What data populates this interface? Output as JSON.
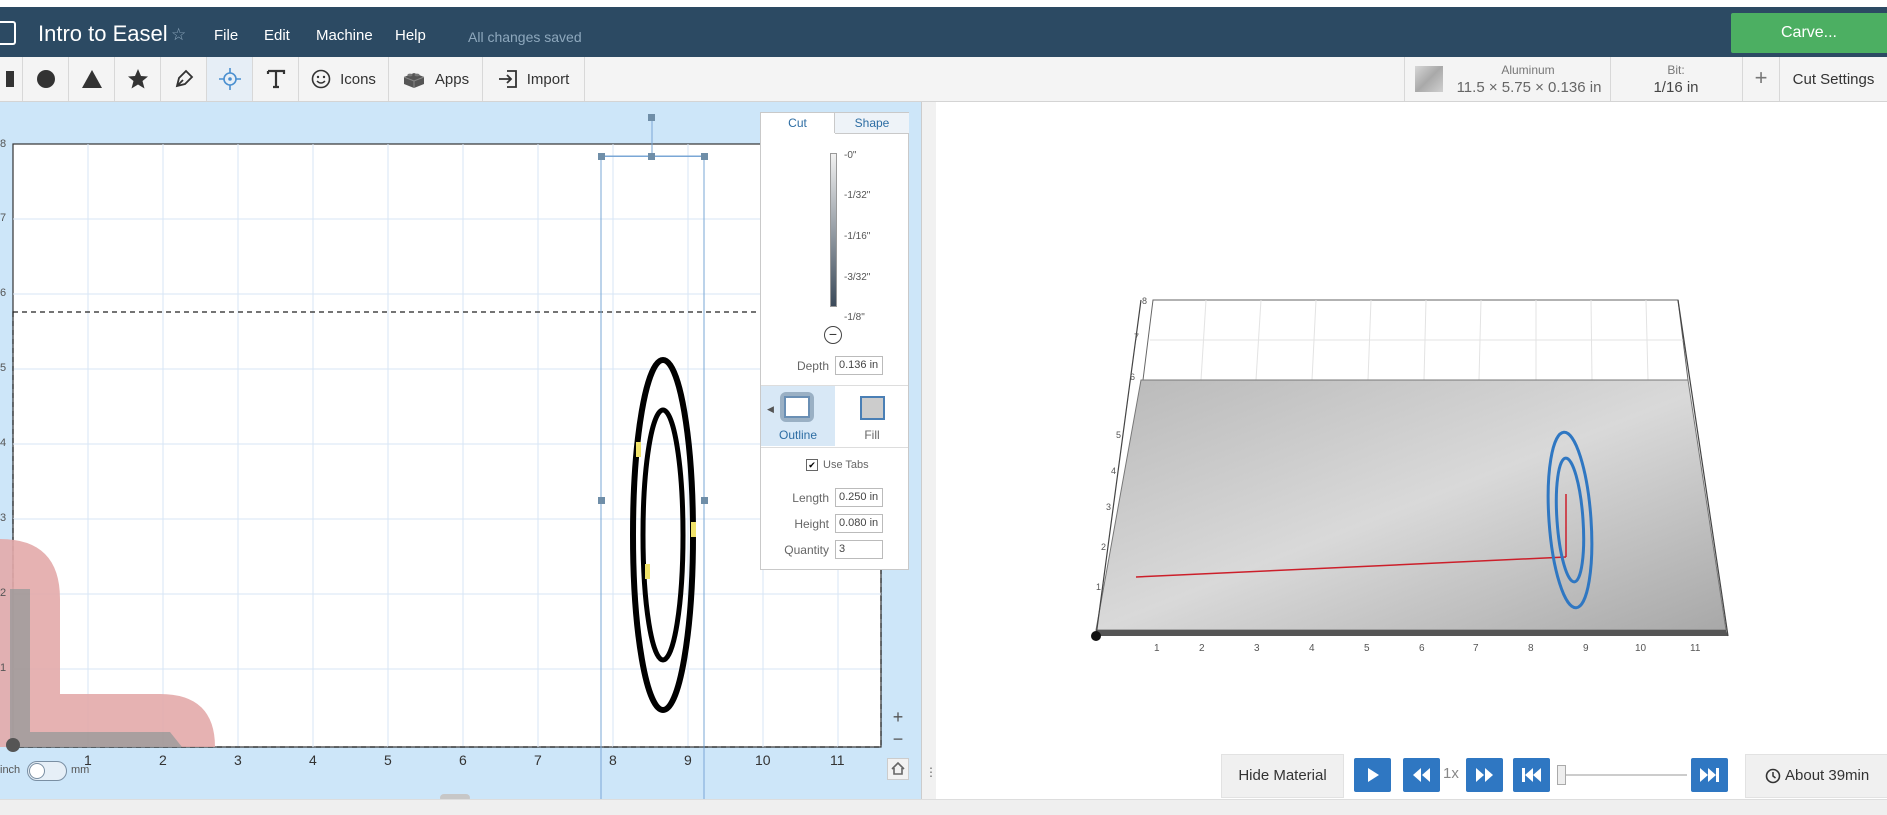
{
  "header": {
    "title": "Intro to Easel",
    "star": "☆",
    "menu": [
      "File",
      "Edit",
      "Machine",
      "Help"
    ],
    "status": "All changes saved",
    "carve_label": "Carve..."
  },
  "toolbar": {
    "icons_label": "Icons",
    "apps_label": "Apps",
    "import_label": "Import",
    "material_name": "Aluminum",
    "material_dims": "11.5 × 5.75 × 0.136 in",
    "bit_label": "Bit:",
    "bit_value": "1/16 in",
    "plus_label": "+",
    "cut_settings_label": "Cut Settings"
  },
  "canvas": {
    "x_ticks": [
      "1",
      "2",
      "3",
      "4",
      "5",
      "6",
      "7",
      "8",
      "9",
      "10",
      "11"
    ],
    "y_ticks": [
      "8",
      "7",
      "6",
      "5",
      "4",
      "3",
      "2",
      "1"
    ],
    "unit_inch": "inch",
    "unit_mm": "mm",
    "zoom_in": "+",
    "zoom_out": "−"
  },
  "cut_panel": {
    "tab_cut": "Cut",
    "tab_shape": "Shape",
    "depth_marks": [
      "-0\"",
      "-1/32\"",
      "-1/16\"",
      "-3/32\"",
      "-1/8\""
    ],
    "depth_label": "Depth",
    "depth_value": "0.136 in",
    "outline_label": "Outline",
    "fill_label": "Fill",
    "use_tabs_label": "Use Tabs",
    "length_label": "Length",
    "length_value": "0.250 in",
    "height_label": "Height",
    "height_value": "0.080 in",
    "quantity_label": "Quantity",
    "quantity_value": "3"
  },
  "preview": {
    "x_ticks": [
      "1",
      "2",
      "3",
      "4",
      "5",
      "6",
      "7",
      "8",
      "9",
      "10",
      "11"
    ],
    "y_ticks": [
      "1",
      "2",
      "3",
      "4",
      "5",
      "6",
      "7",
      "8"
    ],
    "hide_material_label": "Hide Material",
    "speed_label": "1x",
    "time_label": "About 39min"
  },
  "colors": {
    "header_bg": "#2c4a63",
    "carve_green": "#4caf62",
    "canvas_bg": "#cde6f9",
    "toolpath_blue": "#2f77c2",
    "toolpath_red": "#cc1f2a"
  }
}
